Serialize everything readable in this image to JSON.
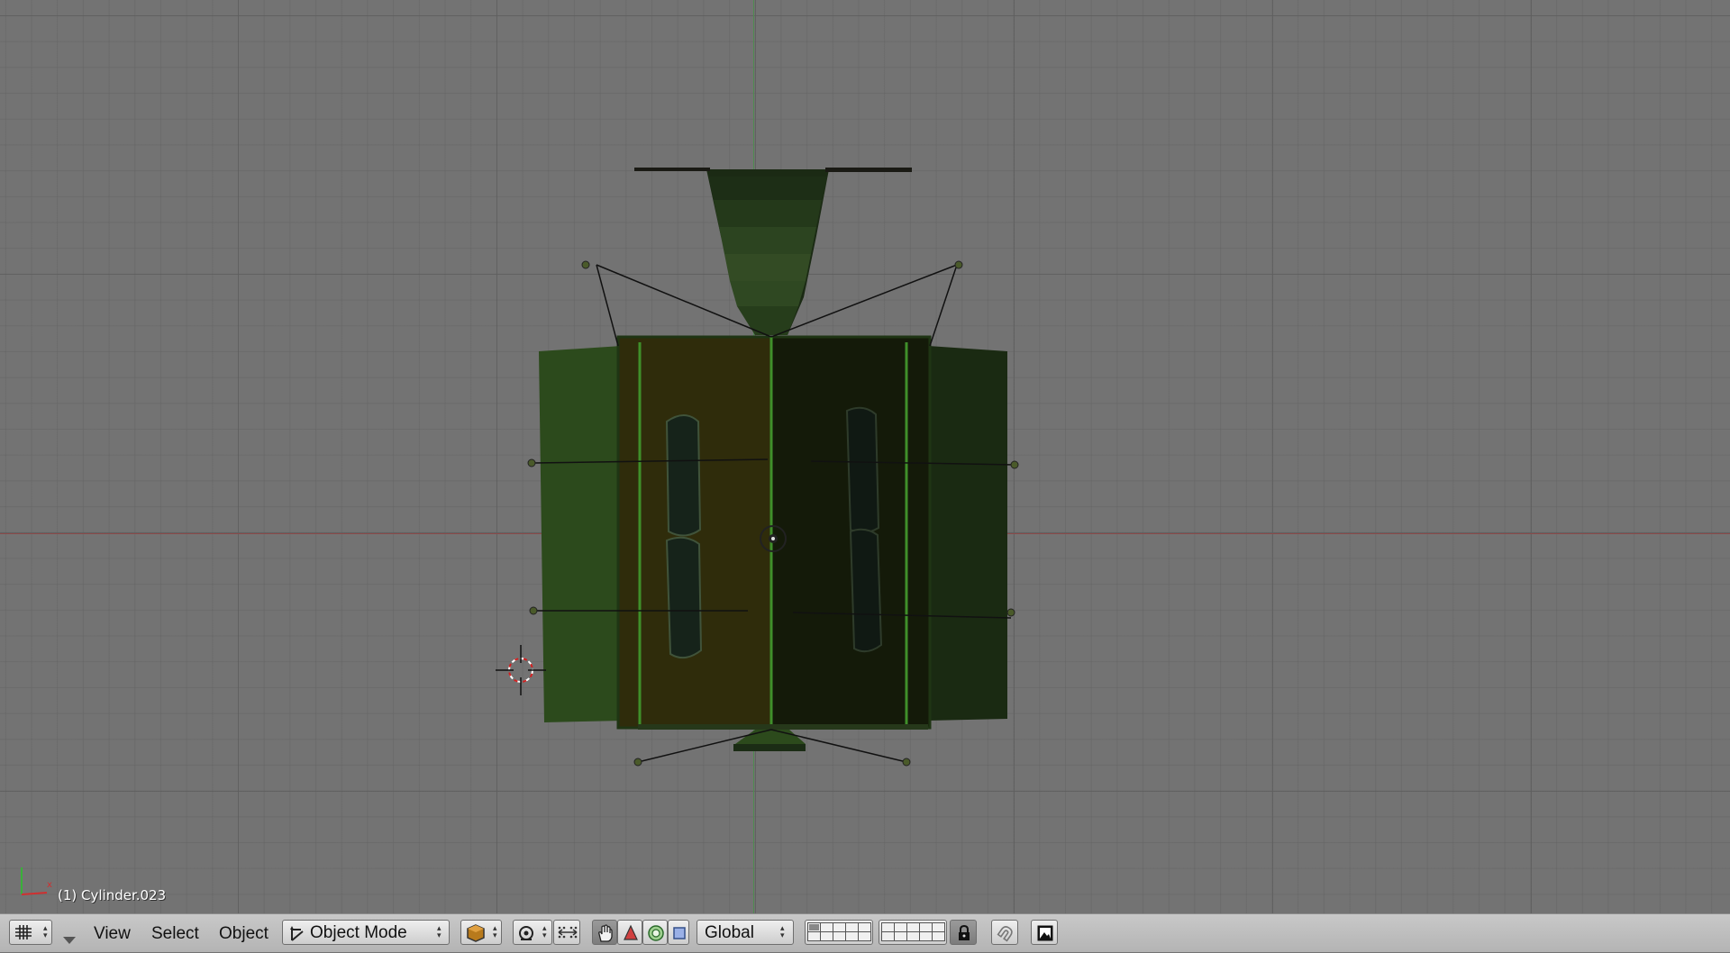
{
  "viewport": {
    "object_label": "(1) Cylinder.023",
    "grid_color": "#5f5f5f",
    "background_color": "#737373",
    "axis_x_color": "#8a4a4a",
    "axis_y_color": "#4f8a4f"
  },
  "header": {
    "editor_type_icon": "grid-icon",
    "menus": {
      "view": "View",
      "select": "Select",
      "object": "Object"
    },
    "mode": {
      "label": "Object Mode",
      "icon": "object-mode-icon"
    },
    "draw_type_icon": "shaded-cube-icon",
    "pivot_icon": "pivot-icon",
    "manipulator_icons": [
      "hand-icon",
      "translate-icon",
      "rotate-icon",
      "scale-icon"
    ],
    "orientation": "Global",
    "layers_icon": "layers-grid-icon",
    "lock_icon": "lock-icon",
    "snap_icon": "snap-magnet-icon",
    "render_icon": "render-icon"
  }
}
